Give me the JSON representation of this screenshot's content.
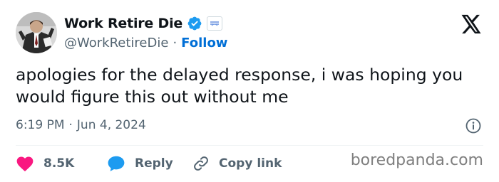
{
  "author": {
    "display_name": "Work Retire Die",
    "handle": "@WorkRetireDie",
    "separator": "·",
    "follow_label": "Follow"
  },
  "tweet": {
    "text": "apologies for the delayed response, i was hoping you would figure this out without me",
    "time": "6:19 PM",
    "date_separator": "·",
    "date": "Jun 4, 2024"
  },
  "actions": {
    "likes": "8.5K",
    "reply_label": "Reply",
    "copy_link_label": "Copy link"
  },
  "watermark": "boredpanda.com",
  "icons": {
    "verified": "verified-badge-icon",
    "affiliate": "affiliate-badge-icon",
    "x_logo": "x-logo-icon",
    "info": "info-icon",
    "like": "heart-icon",
    "reply": "speech-bubble-icon",
    "copy_link": "link-icon"
  },
  "colors": {
    "verified_blue": "#1d9bf0",
    "follow_blue": "#006fd6",
    "heart_red": "#f91880",
    "reply_blue": "#1d9bf0",
    "text_primary": "#0f1419",
    "text_secondary": "#536471"
  }
}
